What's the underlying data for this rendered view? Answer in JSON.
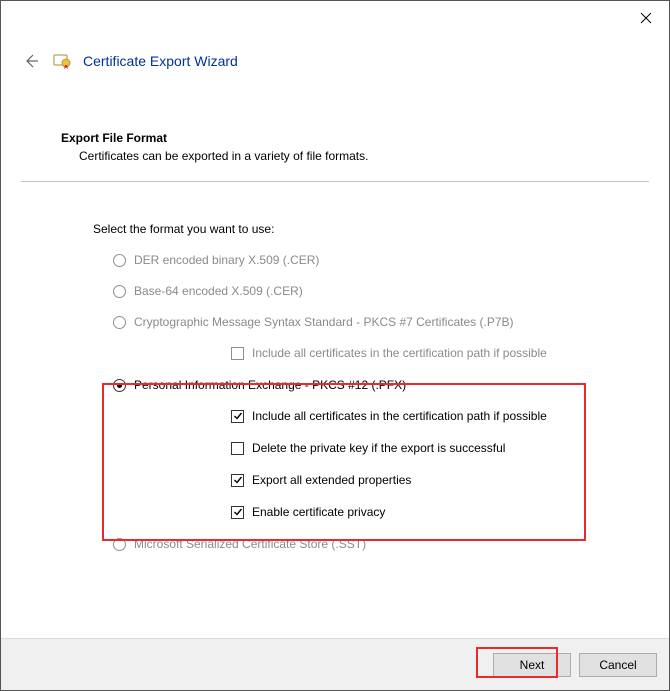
{
  "title": "Certificate Export Wizard",
  "heading": "Export File Format",
  "subheading": "Certificates can be exported in a variety of file formats.",
  "prompt": "Select the format you want to use:",
  "options": {
    "der": {
      "label": "DER encoded binary X.509 (.CER)"
    },
    "base64": {
      "label": "Base-64 encoded X.509 (.CER)"
    },
    "p7b": {
      "label": "Cryptographic Message Syntax Standard - PKCS #7 Certificates (.P7B)"
    },
    "p7b_include": {
      "label": "Include all certificates in the certification path if possible"
    },
    "pfx": {
      "label": "Personal Information Exchange - PKCS #12 (.PFX)"
    },
    "pfx_include": {
      "label": "Include all certificates in the certification path if possible"
    },
    "pfx_delete": {
      "label": "Delete the private key if the export is successful"
    },
    "pfx_export": {
      "label": "Export all extended properties"
    },
    "pfx_privacy": {
      "label": "Enable certificate privacy"
    },
    "sst": {
      "label": "Microsoft Serialized Certificate Store (.SST)"
    }
  },
  "buttons": {
    "next": "Next",
    "cancel": "Cancel"
  }
}
